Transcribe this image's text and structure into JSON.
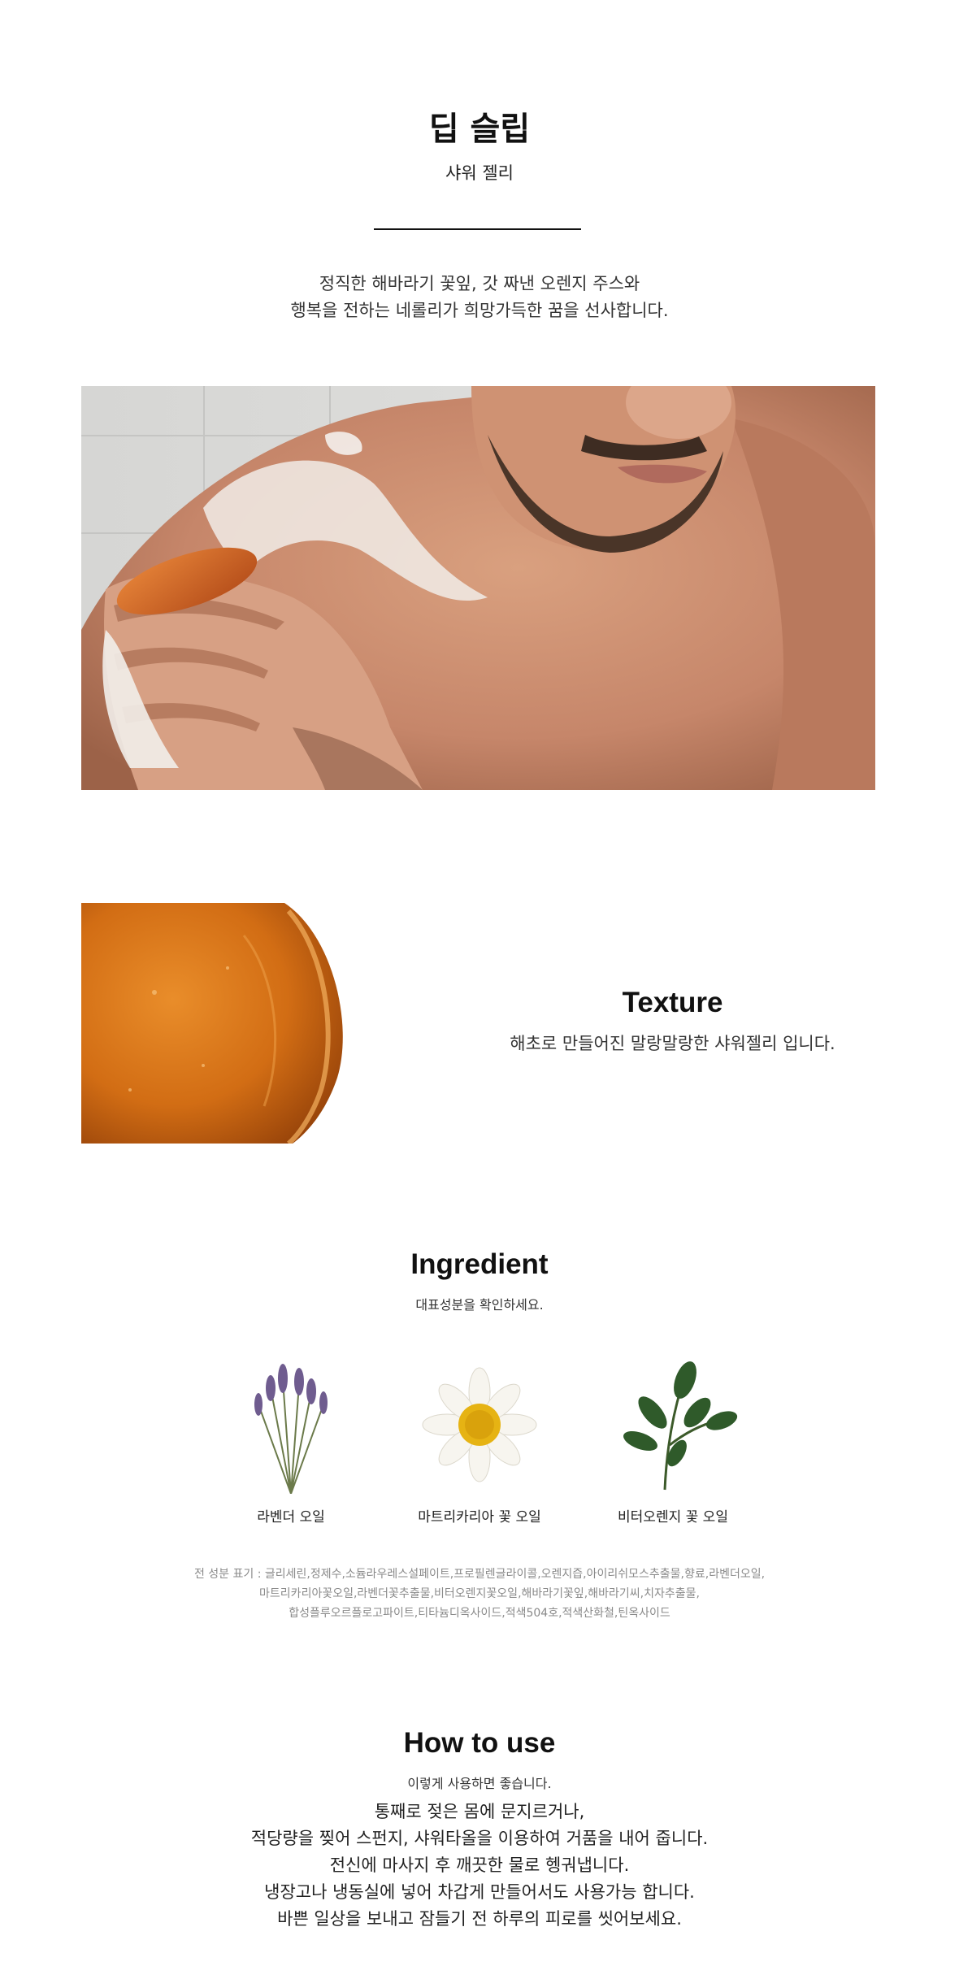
{
  "header": {
    "title": "딥 슬립",
    "subtitle": "샤워 젤리",
    "description": [
      "정직한 해바라기 꽃잎, 갓 짜낸 오렌지 주스와",
      "행복을 전하는 네롤리가 희망가득한 꿈을 선사합니다."
    ]
  },
  "texture": {
    "title": "Texture",
    "description": "해초로 만들어진 말랑말랑한 샤워젤리 입니다."
  },
  "ingredient": {
    "title": "Ingredient",
    "subtitle": "대표성분을 확인하세요.",
    "items": [
      {
        "label": "라벤더 오일",
        "icon": "lavender-icon"
      },
      {
        "label": "마트리카리아 꽃 오일",
        "icon": "chamomile-icon"
      },
      {
        "label": "비터오렌지 꽃 오일",
        "icon": "orange-leaf-icon"
      }
    ],
    "full_list": [
      "전 성분 표기 : 글리세린,정제수,소듐라우레스설페이트,프로필렌글라이콜,오렌지즙,아이리쉬모스추출물,향료,라벤더오일,",
      "마트리카리아꽃오일,라벤더꽃추출물,비터오렌지꽃오일,해바라기꽃잎,해바라기씨,치자추출물,",
      "합성플루오르플로고파이트,티타늄디옥사이드,적색504호,적색산화철,틴옥사이드"
    ]
  },
  "how_to_use": {
    "title": "How to use",
    "subtitle": "이렇게 사용하면 좋습니다.",
    "lines": [
      "통째로 젖은 몸에 문지르거나,",
      "적당량을 찢어 스펀지, 샤워타올을 이용하여 거품을 내어 줍니다.",
      "전신에 마사지 후 깨끗한 물로 헹궈냅니다.",
      "냉장고나 냉동실에 넣어 차갑게 만들어서도 사용가능 합니다.",
      "바쁜 일상을 보내고 잠들기 전 하루의 피로를 씻어보세요."
    ]
  },
  "colors": {
    "jelly_orange": "#d9731a",
    "divider": "#111111"
  }
}
